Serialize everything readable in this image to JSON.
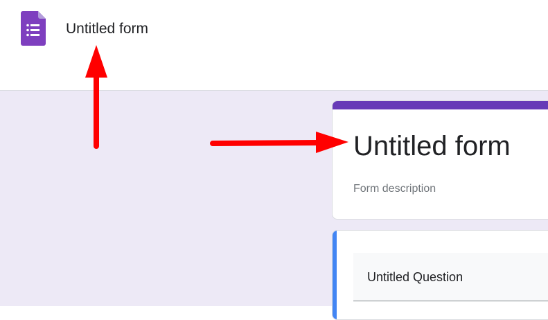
{
  "header": {
    "app_icon": "google-forms-icon",
    "title": "Untitled form"
  },
  "form": {
    "title": "Untitled form",
    "description_placeholder": "Form description",
    "accent_color": "#673ab7",
    "background_color": "#ede9f6"
  },
  "question": {
    "title": "Untitled Question",
    "focus_color": "#4285f4"
  },
  "annotations": {
    "arrow_color": "#ff0000",
    "arrows": [
      "arrow-up-icon",
      "arrow-right-icon"
    ]
  }
}
